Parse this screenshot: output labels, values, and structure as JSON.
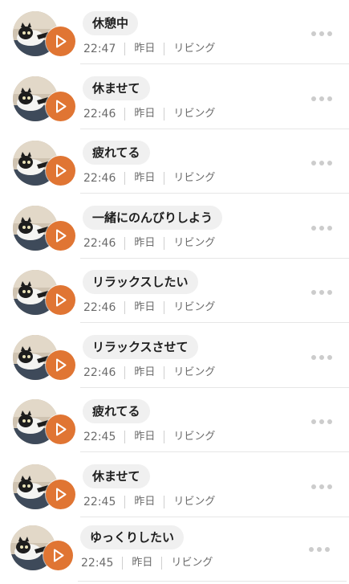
{
  "accent_color": "#e07533",
  "icons": {
    "thumbnail": "cat-photo-icon",
    "play": "play-icon",
    "more": "more-dots-icon"
  },
  "items": [
    {
      "text": "休憩中",
      "time": "22:47",
      "date": "昨日",
      "room": "リビング"
    },
    {
      "text": "休ませて",
      "time": "22:46",
      "date": "昨日",
      "room": "リビング"
    },
    {
      "text": "疲れてる",
      "time": "22:46",
      "date": "昨日",
      "room": "リビング"
    },
    {
      "text": "一緒にのんびりしよう",
      "time": "22:46",
      "date": "昨日",
      "room": "リビング"
    },
    {
      "text": "リラックスしたい",
      "time": "22:46",
      "date": "昨日",
      "room": "リビング"
    },
    {
      "text": "リラックスさせて",
      "time": "22:46",
      "date": "昨日",
      "room": "リビング"
    },
    {
      "text": "疲れてる",
      "time": "22:45",
      "date": "昨日",
      "room": "リビング"
    },
    {
      "text": "休ませて",
      "time": "22:45",
      "date": "昨日",
      "room": "リビング"
    },
    {
      "text": "ゆっくりしたい",
      "time": "22:45",
      "date": "昨日",
      "room": "リビング"
    }
  ]
}
